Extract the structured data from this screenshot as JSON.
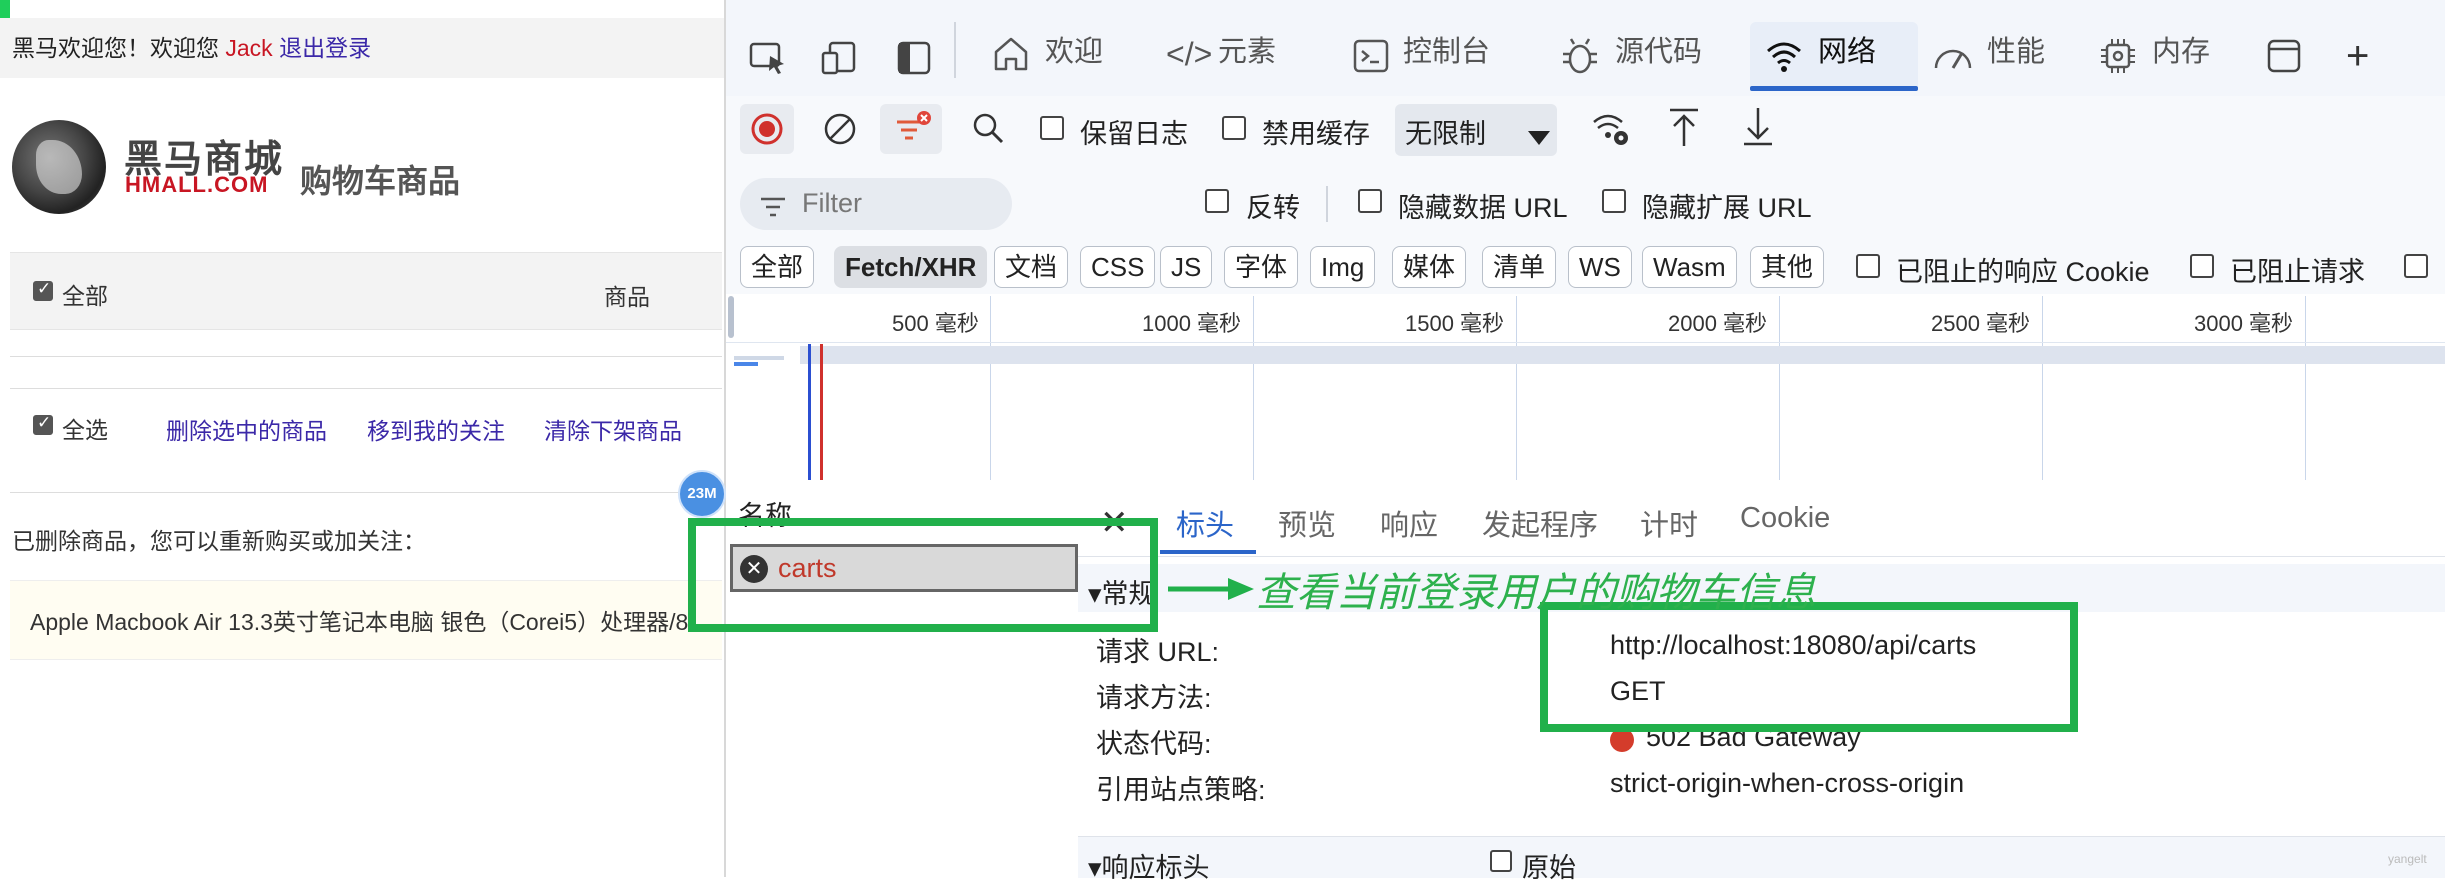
{
  "left_page": {
    "welcome_prefix": "黑马欢迎您！欢迎您",
    "username": "Jack",
    "logout": "退出登录",
    "brand_cn": "黑马商城",
    "brand_en": "HMALL.COM",
    "page_title": "购物车商品",
    "header_select_all": "全部",
    "header_product": "商品",
    "toolbar_select_all": "全选",
    "delete_selected": "删除选中的商品",
    "move_to_favorites": "移到我的关注",
    "clear_offshelf": "清除下架商品",
    "deleted_notice": "已删除商品，您可以重新购买或加关注：",
    "deleted_item": "Apple Macbook Air 13.3英寸笔记本电脑 银色（Corei5）处理器/8",
    "badge": "23M"
  },
  "devtools": {
    "tabs": [
      "欢迎",
      "元素",
      "控制台",
      "源代码",
      "网络",
      "性能",
      "内存"
    ],
    "active_tab": "网络",
    "toolbar": {
      "preserve_log": "保留日志",
      "disable_cache": "禁用缓存",
      "throttling": "无限制"
    },
    "filter": {
      "placeholder": "Filter",
      "invert": "反转",
      "hide_data_urls": "隐藏数据 URL",
      "hide_extension_urls": "隐藏扩展 URL"
    },
    "type_filters": [
      "全部",
      "Fetch/XHR",
      "文档",
      "CSS",
      "JS",
      "字体",
      "Img",
      "媒体",
      "清单",
      "WS",
      "Wasm",
      "其他"
    ],
    "active_type": "Fetch/XHR",
    "blocked_cookies": "已阻止的响应 Cookie",
    "blocked_requests": "已阻止请求",
    "timeline_ticks": [
      "500  毫秒",
      "1000  毫秒",
      "1500  毫秒",
      "2000  毫秒",
      "2500  毫秒",
      "3000  毫秒"
    ],
    "name_header": "名称",
    "request_name": "carts",
    "detail_tabs": [
      "标头",
      "预览",
      "响应",
      "发起程序",
      "计时",
      "Cookie"
    ],
    "active_detail_tab": "标头",
    "general_section": "▾常规",
    "general": {
      "url_label": "请求 URL:",
      "url_value": "http://localhost:18080/api/carts",
      "method_label": "请求方法:",
      "method_value": "GET",
      "status_label": "状态代码:",
      "status_value": "502 Bad Gateway",
      "referrer_label": "引用站点策略:",
      "referrer_value": "strict-origin-when-cross-origin"
    },
    "response_headers": "▾响应标头",
    "raw": "原始"
  },
  "annotation": {
    "text": "查看当前登录用户的购物车信息",
    "color": "#21b04b"
  },
  "watermark": "yangelt",
  "colors": {
    "accent": "#2b65c9",
    "error": "#d43c2b",
    "brand_red": "#c81623",
    "link": "#3b28a8"
  }
}
